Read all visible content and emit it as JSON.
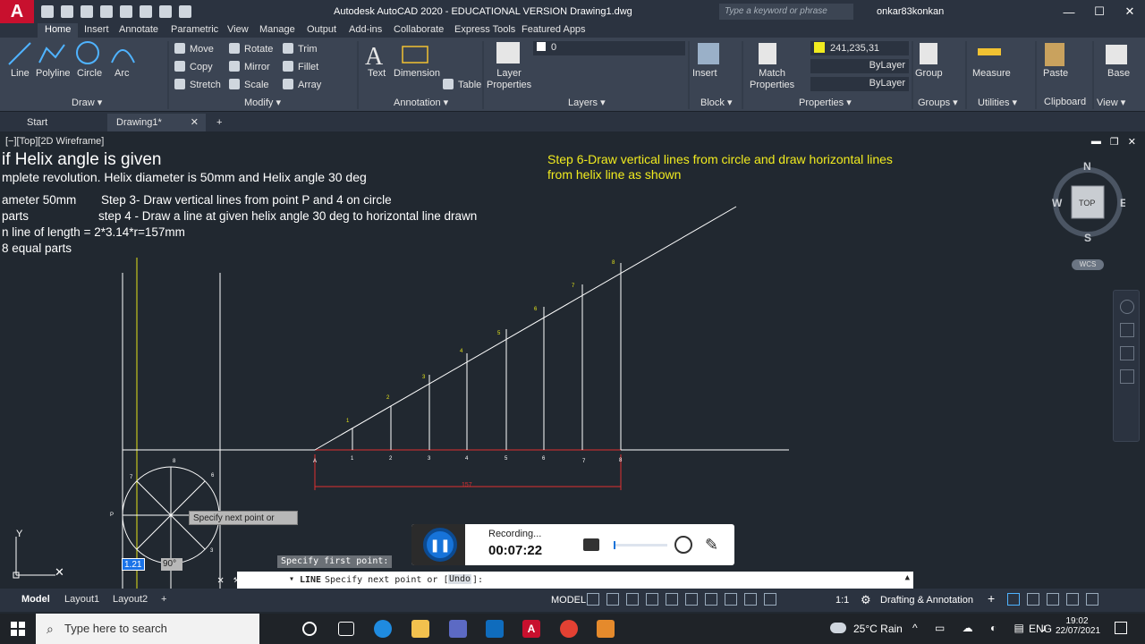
{
  "titlebar": {
    "title": "Autodesk AutoCAD 2020 - EDUCATIONAL VERSION    Drawing1.dwg",
    "search_placeholder": "Type a keyword or phrase",
    "user": "onkar83konkan"
  },
  "menu": {
    "tabs": [
      "Home",
      "Insert",
      "Annotate",
      "Parametric",
      "View",
      "Manage",
      "Output",
      "Add-ins",
      "Collaborate",
      "Express Tools",
      "Featured Apps"
    ]
  },
  "ribbon": {
    "draw": {
      "line": "Line",
      "polyline": "Polyline",
      "circle": "Circle",
      "arc": "Arc",
      "panel": "Draw ▾"
    },
    "modify": {
      "move": "Move",
      "rotate": "Rotate",
      "trim": "Trim",
      "copy": "Copy",
      "mirror": "Mirror",
      "fillet": "Fillet",
      "stretch": "Stretch",
      "scale": "Scale",
      "array": "Array",
      "panel": "Modify ▾"
    },
    "annotation": {
      "text": "Text",
      "dimension": "Dimension",
      "table": "Table",
      "panel": "Annotation ▾"
    },
    "layers": {
      "layer_properties": "Layer\nProperties",
      "current_layer": "0",
      "panel": "Layers ▾"
    },
    "block": {
      "insert": "Insert",
      "panel": "Block ▾"
    },
    "properties": {
      "match": "Match\nProperties",
      "color": "241,235,31",
      "linetype1": "ByLayer",
      "linetype2": "ByLayer",
      "panel": "Properties ▾"
    },
    "groups": {
      "group": "Group",
      "panel": "Groups ▾"
    },
    "utilities": {
      "measure": "Measure",
      "panel": "Utilities ▾"
    },
    "clipboard": {
      "paste": "Paste",
      "panel": "Clipboard"
    },
    "view": {
      "base": "Base",
      "panel": "View ▾"
    }
  },
  "filetabs": {
    "start": "Start",
    "drawing": "Drawing1*"
  },
  "viewport": {
    "label": "[−][Top][2D Wireframe]",
    "notes": {
      "heading": "if Helix angle is given",
      "line1": "mplete revolution. Helix diameter is 50mm and Helix angle 30 deg",
      "line2a": "ameter 50mm",
      "line2b": "Step 3- Draw vertical lines from point P and 4 on circle",
      "line3a": " parts",
      "line3b": "step 4 - Draw a line at given helix angle 30 deg to horizontal line drawn",
      "line4": "n line of length = 2*3.14*r=157mm",
      "line5": "8 equal parts",
      "step6": "Step 6-Draw vertical lines from circle and draw horizontal lines from helix line as shown"
    },
    "dimension_text": "157",
    "point_label": "P",
    "base_labels": [
      "A",
      "1",
      "2",
      "3",
      "4",
      "5",
      "6",
      "7",
      "8"
    ],
    "helix_labels": [
      "1",
      "2",
      "3",
      "4",
      "5",
      "6",
      "7",
      "8"
    ],
    "circle_labels": [
      "8",
      "7",
      "6",
      "3"
    ]
  },
  "navcube": {
    "n": "N",
    "s": "S",
    "e": "E",
    "w": "W",
    "top": "TOP",
    "wcs": "WCS"
  },
  "drawing_overlays": {
    "tooltip": "Specify next point or",
    "dyn_length": "1.21",
    "dyn_angle": "90°",
    "prompt_above": "Specify first point:"
  },
  "cmdline": {
    "cmd": "LINE",
    "text": "Specify next point or [",
    "undo": "Undo",
    "text_end": "]:"
  },
  "recorder": {
    "status": "Recording...",
    "time": "00:07:22"
  },
  "status": {
    "layouts": [
      "Model",
      "Layout1",
      "Layout2"
    ],
    "model": "MODEL",
    "scale": "1:1",
    "workspace": "Drafting & Annotation"
  },
  "taskbar": {
    "search": "Type here to search",
    "weather": "25°C  Rain",
    "lang": "ENG",
    "time": "19:02",
    "date": "22/07/2021"
  },
  "colors": {
    "accent": "#1673d9",
    "autocad_red": "#c8102e",
    "annotation_yellow": "#f1eb1f"
  }
}
